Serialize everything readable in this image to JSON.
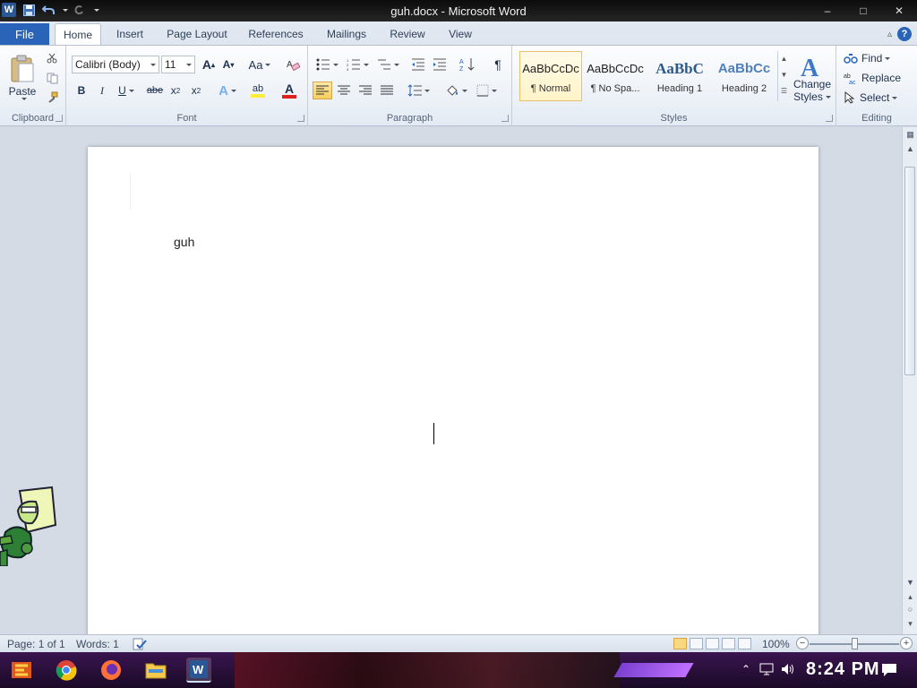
{
  "window": {
    "title": "guh.docx  -  Microsoft Word",
    "app_icon_letter": "W",
    "min_glyph": "–",
    "max_glyph": "□",
    "close_glyph": "✕"
  },
  "tabs": {
    "file": "File",
    "items": [
      "Home",
      "Insert",
      "Page Layout",
      "References",
      "Mailings",
      "Review",
      "View"
    ],
    "active": "Home"
  },
  "ribbon": {
    "clipboard": {
      "label": "Clipboard",
      "paste": "Paste"
    },
    "font": {
      "label": "Font",
      "font_name": "Calibri (Body)",
      "font_size": "11",
      "grow": "A",
      "shrink": "A",
      "case": "Aa",
      "bold": "B",
      "italic": "I",
      "underline": "U",
      "strike": "abe",
      "sub": "x",
      "sup": "x",
      "font_color": "A",
      "highlight": "ab"
    },
    "paragraph": {
      "label": "Paragraph",
      "pilcrow": "¶"
    },
    "styles": {
      "label": "Styles",
      "items": [
        {
          "preview": "AaBbCcDc",
          "name": "¶ Normal",
          "selected": true
        },
        {
          "preview": "AaBbCcDc",
          "name": "¶ No Spa..."
        },
        {
          "preview": "AaBbC",
          "name": "Heading 1"
        },
        {
          "preview": "AaBbCc",
          "name": "Heading 2"
        }
      ],
      "change_styles_1": "Change",
      "change_styles_2": "Styles"
    },
    "editing": {
      "label": "Editing",
      "find": "Find",
      "replace": "Replace",
      "select": "Select"
    }
  },
  "document": {
    "text": "guh"
  },
  "status": {
    "page": "Page: 1 of 1",
    "words": "Words: 1",
    "zoom": "100%",
    "zoom_level": 0.5
  },
  "taskbar": {
    "clock": "8:24 PM",
    "apps": [
      "file-explorer-icon",
      "chrome-icon",
      "firefox-icon",
      "folder-icon",
      "word-icon"
    ]
  },
  "colors": {
    "file_tab": "#2a64b8",
    "accent_font_color": "#e02020",
    "highlight": "#ffef3a"
  }
}
